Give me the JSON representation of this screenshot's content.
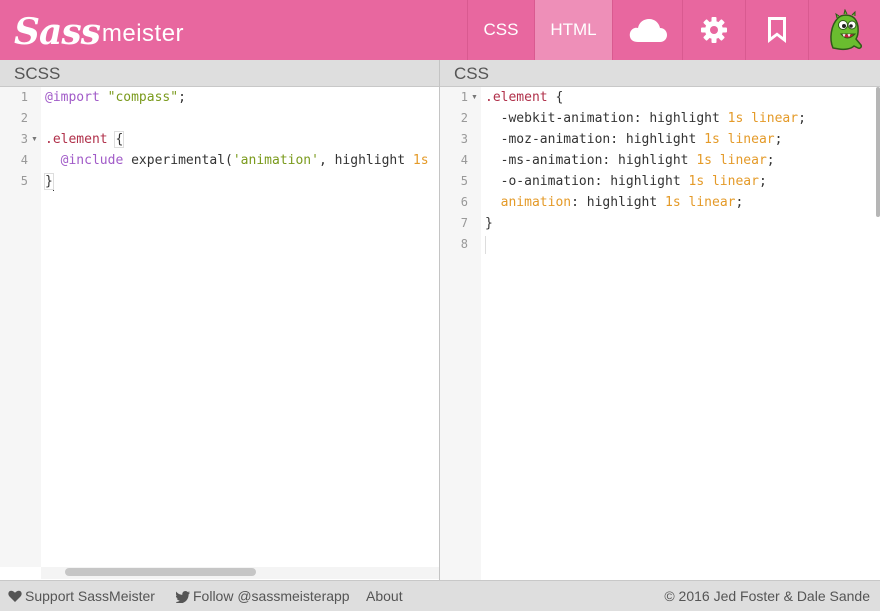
{
  "header": {
    "logo_sass": "Sass",
    "logo_meister": "meister",
    "nav": {
      "css_label": "CSS",
      "html_label": "HTML",
      "icons": [
        "cloud-icon",
        "gear-icon",
        "bookmark-icon",
        "mascot-icon"
      ]
    }
  },
  "panes": {
    "left": {
      "title": "SCSS",
      "line_numbers": [
        "1",
        "2",
        "3",
        "4",
        "5"
      ],
      "lines": {
        "l1": {
          "kw": "@import",
          "sp": " ",
          "str": "\"compass\"",
          "end": ";"
        },
        "l3": {
          "sel": ".element",
          "sp": " ",
          "brace": "{"
        },
        "l4": {
          "indent": "  ",
          "kw": "@include",
          "mid": " experimental(",
          "str": "'animation'",
          "rest": ", highlight ",
          "num": "1s"
        },
        "l5": {
          "brace": "}"
        }
      }
    },
    "right": {
      "title": "CSS",
      "line_numbers": [
        "1",
        "2",
        "3",
        "4",
        "5",
        "6",
        "7",
        "8"
      ],
      "lines": {
        "l1": {
          "sel": ".element",
          "rest": " {"
        },
        "l2": {
          "prop": "  -webkit-animation: highlight ",
          "num": "1s",
          "sp": " ",
          "kw": "linear",
          "end": ";"
        },
        "l3": {
          "prop": "  -moz-animation: highlight ",
          "num": "1s",
          "sp": " ",
          "kw": "linear",
          "end": ";"
        },
        "l4": {
          "prop": "  -ms-animation: highlight ",
          "num": "1s",
          "sp": " ",
          "kw": "linear",
          "end": ";"
        },
        "l5": {
          "prop": "  -o-animation: highlight ",
          "num": "1s",
          "sp": " ",
          "kw": "linear",
          "end": ";"
        },
        "l6": {
          "indent": "  ",
          "attr": "animation",
          "rest": ": highlight ",
          "num": "1s",
          "sp": " ",
          "kw": "linear",
          "end": ";"
        },
        "l7": {
          "brace": "}"
        }
      }
    }
  },
  "footer": {
    "support_label": "Support SassMeister",
    "follow_label": "Follow @sassmeisterapp",
    "about_label": "About",
    "copyright": "© 2016 Jed Foster & Dale Sande"
  },
  "colors": {
    "header_bg": "#e8679f",
    "active_tab_bg": "#ee8fb8",
    "keyword": "#a15bc8",
    "string": "#7a9a1c",
    "selector": "#b0304a",
    "number": "#e49a28"
  }
}
